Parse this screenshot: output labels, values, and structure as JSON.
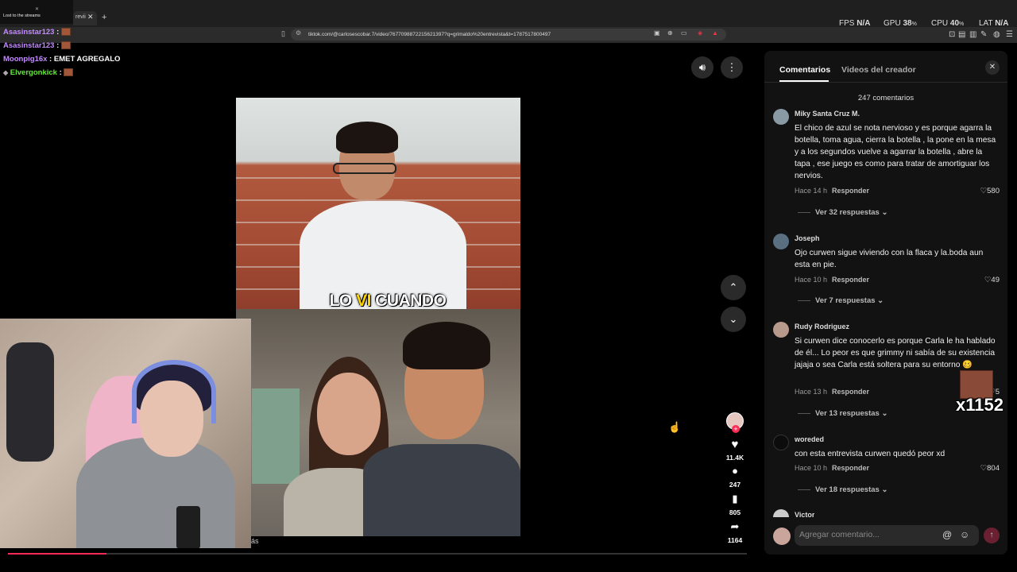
{
  "browser": {
    "tab_label": "revii",
    "tab_close": "✕",
    "tab_new": "+",
    "url": "tiktok.com/@carlosescobar.7/video/7677098872215621397?q=grimaldo%20entrevista&t=1787517800497"
  },
  "perf": {
    "fps_label": "FPS",
    "fps_value": "N/A",
    "gpu_label": "GPU",
    "gpu_value": "38",
    "cpu_label": "CPU",
    "cpu_value": "40",
    "lat_label": "LAT",
    "lat_value": "N/A",
    "unit": "%"
  },
  "stream": {
    "title": "Lost to the streams"
  },
  "chat": [
    {
      "user": "Asasinstar123",
      "sep": " :",
      "msg": "",
      "color": "#c48cff"
    },
    {
      "user": "Asasinstar123",
      "sep": " :",
      "msg": "",
      "color": "#c48cff"
    },
    {
      "user": "Moonpig16x",
      "sep": " :",
      "msg": " EMET AGREGALO",
      "color": "#c48cff"
    },
    {
      "user": "Elvergonkick",
      "sep": " :",
      "msg": "",
      "color": "#64e83a"
    }
  ],
  "video": {
    "caption_pre": "LO ",
    "caption_hl": "VI",
    "caption_post": " CUANDO",
    "cam_label": "ás"
  },
  "rail": {
    "likes": "11.4K",
    "comments": "247",
    "saves": "805",
    "shares": "1164"
  },
  "panel": {
    "tab_comments": "Comentarios",
    "tab_creator": "Videos del creador",
    "count": "247 comentarios",
    "reply_label": "Responder",
    "input_placeholder": "Agregar comentario...",
    "comments": [
      {
        "user": "Miky Santa Cruz M.",
        "text": "El chico de azul se nota nervioso y es porque agarra la botella, toma agua, cierra la botella , la pone en la mesa y a los segundos vuelve a agarrar la botella , abre la tapa , ese juego es como para tratar de amortiguar los nervios.",
        "time": "Hace 14 h",
        "likes": "580",
        "more": "Ver 32 respuestas"
      },
      {
        "user": "Joseph",
        "text": "Ojo curwen sigue viviendo con la flaca y la.boda aun esta en pie.",
        "time": "Hace 10 h",
        "likes": "49",
        "more": "Ver 7 respuestas"
      },
      {
        "user": "Rudy Rodriguez",
        "text": "Si curwen dice conocerlo es porque Carla le ha hablado de él... Lo peor es que grimmy ni sabía de su existencia jajaja o sea Carla está soltera para su entorno 🥴",
        "time": "Hace 13 h",
        "likes": "5",
        "more": "Ver 13 respuestas"
      },
      {
        "user": "woreded",
        "text": "con esta entrevista curwen quedó peor xd",
        "time": "Hace 10 h",
        "likes": "804",
        "more": "Ver 18 respuestas"
      },
      {
        "user": "Victor",
        "text": "",
        "time": "",
        "likes": "",
        "more": ""
      }
    ]
  },
  "overlay_emote": {
    "count": "x1152"
  },
  "colors": {
    "accent": "#fe2c55",
    "panel_bg": "#121212"
  }
}
